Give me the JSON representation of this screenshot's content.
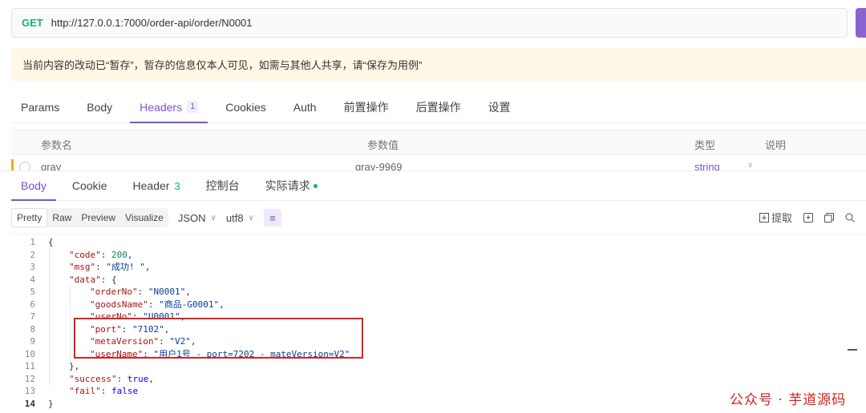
{
  "request": {
    "method": "GET",
    "url": "http://127.0.0.1:7000/order-api/order/N0001"
  },
  "notice": "当前内容的改动已“暂存”，暂存的信息仅本人可见，如需与其他人共享，请“保存为用例”",
  "request_tabs": [
    {
      "label": "Params"
    },
    {
      "label": "Body"
    },
    {
      "label": "Headers",
      "badge": "1"
    },
    {
      "label": "Cookies"
    },
    {
      "label": "Auth"
    },
    {
      "label": "前置操作"
    },
    {
      "label": "后置操作"
    },
    {
      "label": "设置"
    }
  ],
  "headers_table": {
    "columns": [
      "参数名",
      "参数值",
      "类型",
      "说明"
    ],
    "row": {
      "name": "gray",
      "value": "gray-9969",
      "type": "string"
    }
  },
  "response_tabs": [
    {
      "label": "Body"
    },
    {
      "label": "Cookie"
    },
    {
      "label": "Header",
      "count": "3"
    },
    {
      "label": "控制台"
    },
    {
      "label": "实际请求"
    }
  ],
  "format_bar": {
    "views": [
      "Pretty",
      "Raw",
      "Preview",
      "Visualize"
    ],
    "format": "JSON",
    "encoding": "utf8",
    "extract_label": "提取"
  },
  "code_lines": [
    {
      "n": "1",
      "indent": 0,
      "parts": [
        [
          "p",
          "{"
        ]
      ]
    },
    {
      "n": "2",
      "indent": 1,
      "parts": [
        [
          "k",
          "\"code\""
        ],
        [
          "p",
          ": "
        ],
        [
          "n",
          "200"
        ],
        [
          "p",
          ","
        ]
      ]
    },
    {
      "n": "3",
      "indent": 1,
      "parts": [
        [
          "k",
          "\"msg\""
        ],
        [
          "p",
          ": "
        ],
        [
          "s",
          "\"成功! \""
        ],
        [
          "p",
          ","
        ]
      ]
    },
    {
      "n": "4",
      "indent": 1,
      "parts": [
        [
          "k",
          "\"data\""
        ],
        [
          "p",
          ": {"
        ]
      ]
    },
    {
      "n": "5",
      "indent": 2,
      "parts": [
        [
          "k",
          "\"orderNo\""
        ],
        [
          "p",
          ": "
        ],
        [
          "s",
          "\"N0001\""
        ],
        [
          "p",
          ","
        ]
      ]
    },
    {
      "n": "6",
      "indent": 2,
      "parts": [
        [
          "k",
          "\"goodsName\""
        ],
        [
          "p",
          ": "
        ],
        [
          "s",
          "\"商品-G0001\""
        ],
        [
          "p",
          ","
        ]
      ]
    },
    {
      "n": "7",
      "indent": 2,
      "parts": [
        [
          "k",
          "\"userNo\""
        ],
        [
          "p",
          ": "
        ],
        [
          "s",
          "\"U0001\""
        ],
        [
          "p",
          ","
        ]
      ]
    },
    {
      "n": "8",
      "indent": 2,
      "parts": [
        [
          "k",
          "\"port\""
        ],
        [
          "p",
          ": "
        ],
        [
          "s",
          "\"7102\""
        ],
        [
          "p",
          ","
        ]
      ]
    },
    {
      "n": "9",
      "indent": 2,
      "parts": [
        [
          "k",
          "\"metaVersion\""
        ],
        [
          "p",
          ": "
        ],
        [
          "s",
          "\"V2\""
        ],
        [
          "p",
          ","
        ]
      ]
    },
    {
      "n": "10",
      "indent": 2,
      "parts": [
        [
          "k",
          "\"userName\""
        ],
        [
          "p",
          ": "
        ],
        [
          "s",
          "\"用户1号 - port=7202 - mateVersion=V2\""
        ]
      ]
    },
    {
      "n": "11",
      "indent": 1,
      "parts": [
        [
          "p",
          "},"
        ]
      ]
    },
    {
      "n": "12",
      "indent": 1,
      "parts": [
        [
          "k",
          "\"success\""
        ],
        [
          "p",
          ": "
        ],
        [
          "b",
          "true"
        ],
        [
          "p",
          ","
        ]
      ]
    },
    {
      "n": "13",
      "indent": 1,
      "parts": [
        [
          "k",
          "\"fail\""
        ],
        [
          "p",
          ": "
        ],
        [
          "b",
          "false"
        ]
      ]
    },
    {
      "n": "14",
      "indent": 0,
      "parts": [
        [
          "p",
          "}"
        ]
      ]
    }
  ],
  "watermark": "公众号 · 芋道源码",
  "colors": {
    "accent": "#7a52d0",
    "method": "#17b26a",
    "highlight_box": "#e02020"
  }
}
